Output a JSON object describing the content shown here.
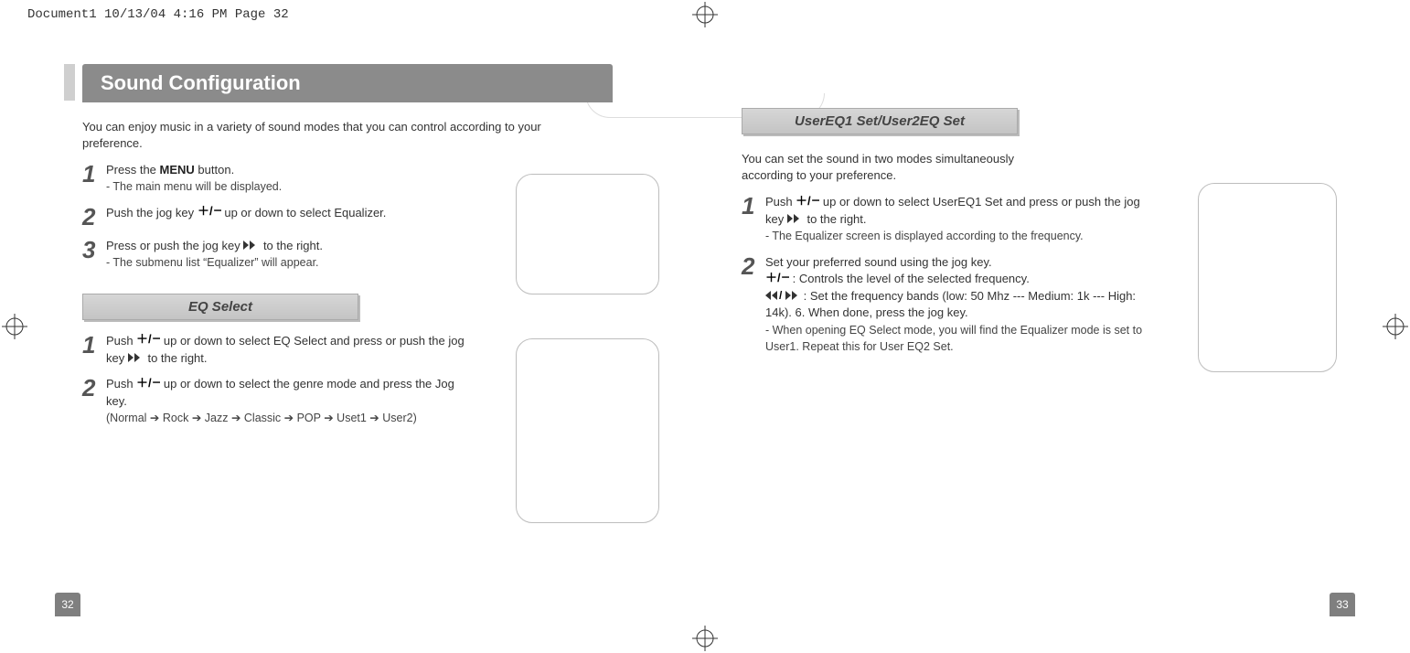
{
  "header_line": "Document1  10/13/04  4:16 PM  Page 32",
  "left": {
    "title": "Sound Configuration",
    "intro": "You can enjoy music in a variety of sound modes that you can control according to your preference.",
    "step1_a": "Press the ",
    "step1_menu": "MENU",
    "step1_b": " button.",
    "step1_sub": "- The main menu will be displayed.",
    "step2": "Push the jog key ",
    "step2_b": " up or down to select Equalizer.",
    "step3_a": "Press or push the jog key ",
    "step3_b": " to the right.",
    "step3_sub": "- The submenu list “Equalizer” will appear.",
    "eq_select_title": "EQ Select",
    "eq1_a": "Push ",
    "eq1_b": " up or down to select EQ Select and press or push the jog key ",
    "eq1_c": " to the right.",
    "eq2_a": "Push ",
    "eq2_b": " up or down to select the genre mode and press the Jog key.",
    "eq2_sub": "(Normal ➔ Rock ➔ Jazz ➔ Classic ➔ POP ➔ Uset1 ➔ User2)",
    "page_num": "32"
  },
  "right": {
    "sect_title": "UserEQ1 Set/User2EQ Set",
    "intro": "You can set the sound in two modes simultaneously according to your preference.",
    "s1_a": "Push ",
    "s1_b": " up or down to select UserEQ1 Set and press or push the jog key ",
    "s1_c": " to the right.",
    "s1_sub": "- The Equalizer screen is displayed according to the frequency.",
    "s2_a": "Set your preferred sound using the jog key.",
    "s2_line2": " : Controls the level of the selected frequency.",
    "s2_line3": " : Set the frequency bands (low: 50 Mhz --- Medium: 1k --- High: 14k). 6. When done, press the jog key.",
    "s2_sub": "- When opening EQ Select mode, you will find the Equalizer mode is set to User1. Repeat this for User EQ2 Set.",
    "page_num": "33"
  },
  "nums": {
    "n1": "1",
    "n2": "2",
    "n3": "3"
  }
}
